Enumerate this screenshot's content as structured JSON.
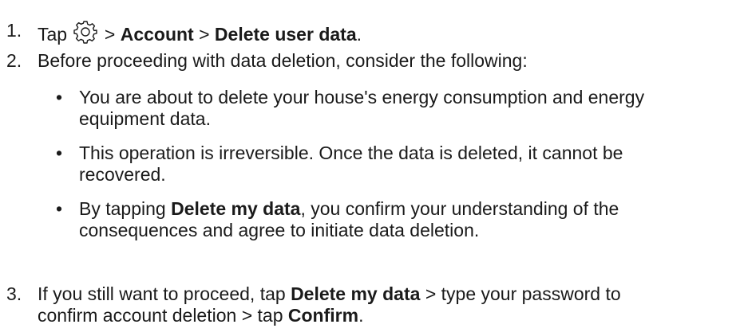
{
  "steps": [
    {
      "number": "1.",
      "tap": "Tap",
      "icon": "gear-icon",
      "sep1": ">",
      "account": "Account",
      "sep2": ">",
      "delete_user_data": "Delete user data",
      "end": "."
    },
    {
      "number": "2.",
      "text": "Before proceeding with data deletion, consider the following:",
      "bullets": [
        {
          "symbol": "•",
          "line1": "You are about to delete your house's energy consumption and energy",
          "line2": "equipment data."
        },
        {
          "symbol": "•",
          "line1": "This operation is irreversible. Once the data is deleted, it cannot be",
          "line2": "recovered."
        },
        {
          "symbol": "•",
          "pre": "By tapping",
          "bold": "Delete my data",
          "post": ", you confirm your understanding of the",
          "line2": "consequences and agree to initiate data deletion."
        }
      ]
    },
    {
      "number": "3.",
      "pre": "If you still want to proceed, tap",
      "bold1": "Delete my data",
      "mid": "> type your password to",
      "line2_pre": "confirm account deletion > tap",
      "bold2": "Confirm",
      "end": "."
    }
  ]
}
